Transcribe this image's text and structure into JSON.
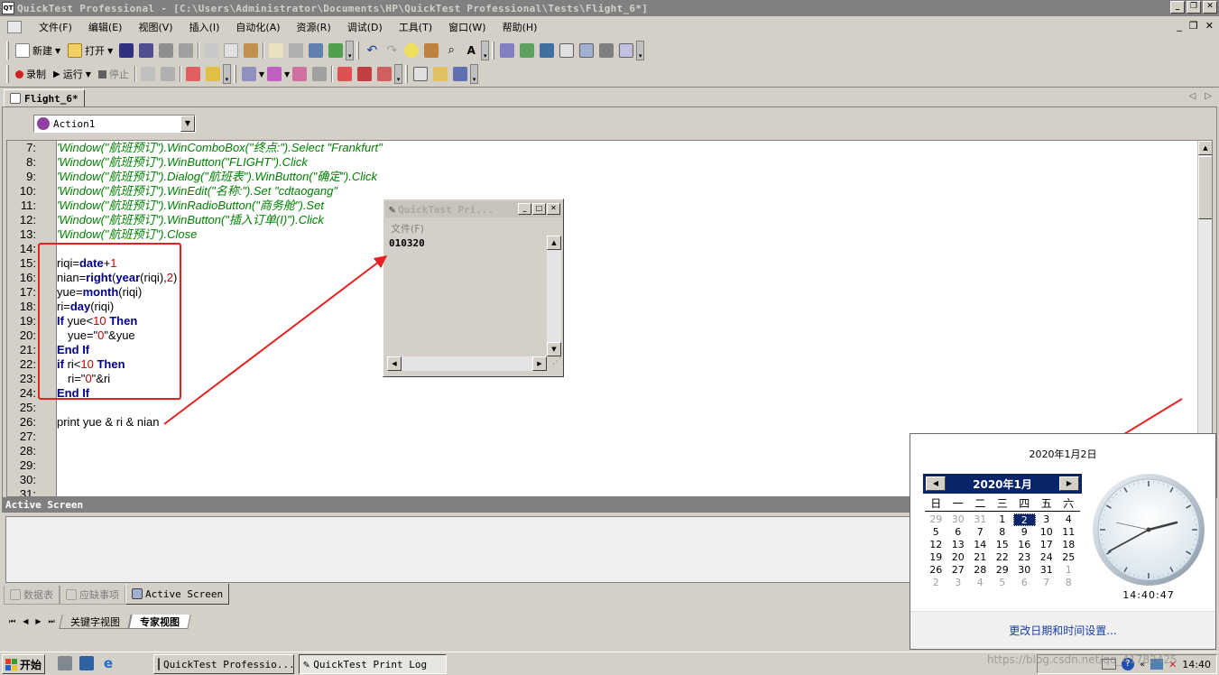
{
  "window": {
    "title": "QuickTest Professional - [C:\\Users\\Administrator\\Documents\\HP\\QuickTest Professional\\Tests\\Flight_6*]"
  },
  "menu": {
    "items": [
      "文件(F)",
      "编辑(E)",
      "视图(V)",
      "插入(I)",
      "自动化(A)",
      "资源(R)",
      "调试(D)",
      "工具(T)",
      "窗口(W)",
      "帮助(H)"
    ]
  },
  "toolbar1": {
    "new_label": "新建",
    "open_label": "打开"
  },
  "toolbar2": {
    "record_label": "录制",
    "run_label": "运行",
    "stop_label": "停止"
  },
  "doc_tab": {
    "label": "Flight_6*"
  },
  "action_combo": {
    "value": "Action1"
  },
  "code_lines": [
    {
      "n": "7:",
      "text": "'Window(\"航班预订\").WinComboBox(\"终点:\").Select \"Frankfurt\""
    },
    {
      "n": "8:",
      "text": "'Window(\"航班预订\").WinButton(\"FLIGHT\").Click"
    },
    {
      "n": "9:",
      "text": "'Window(\"航班预订\").Dialog(\"航班表\").WinButton(\"确定\").Click"
    },
    {
      "n": "10:",
      "text": "'Window(\"航班预订\").WinEdit(\"名称:\").Set \"cdtaogang\""
    },
    {
      "n": "11:",
      "text": "'Window(\"航班预订\").WinRadioButton(\"商务舱\").Set"
    },
    {
      "n": "12:",
      "text": "'Window(\"航班预订\").WinButton(\"插入订单(I)\").Click"
    },
    {
      "n": "13:",
      "text": "'Window(\"航班预订\").Close"
    },
    {
      "n": "14:",
      "text": ""
    },
    {
      "n": "15:",
      "text": "riqi=date+1"
    },
    {
      "n": "16:",
      "text": "nian=right(year(riqi),2)"
    },
    {
      "n": "17:",
      "text": "yue=month(riqi)"
    },
    {
      "n": "18:",
      "text": "ri=day(riqi)"
    },
    {
      "n": "19:",
      "text": "If yue<10 Then"
    },
    {
      "n": "20:",
      "text": "yue=\"0\"&yue"
    },
    {
      "n": "21:",
      "text": "End If"
    },
    {
      "n": "22:",
      "text": "if ri<10 Then"
    },
    {
      "n": "23:",
      "text": "ri=\"0\"&ri"
    },
    {
      "n": "24:",
      "text": "End If"
    },
    {
      "n": "25:",
      "text": ""
    },
    {
      "n": "26:",
      "text": "print yue & ri & nian"
    },
    {
      "n": "27:",
      "text": ""
    },
    {
      "n": "28:",
      "text": ""
    },
    {
      "n": "29:",
      "text": ""
    },
    {
      "n": "30:",
      "text": ""
    },
    {
      "n": "31:",
      "text": ""
    }
  ],
  "print_log": {
    "title": "QuickTest Pri...",
    "menu_file": "文件(F)",
    "output": "010320"
  },
  "active_screen": {
    "header": "Active Screen"
  },
  "bottom_tabs": {
    "data_table": "数据表",
    "missing_resources": "应缺事项",
    "active_screen": "Active Screen"
  },
  "view_tabs": {
    "keyword_view": "关键字视图",
    "expert_view": "专家视图"
  },
  "clock_popup": {
    "date_long": "2020年1月2日",
    "month_title": "2020年1月",
    "weekdays": [
      "日",
      "一",
      "二",
      "三",
      "四",
      "五",
      "六"
    ],
    "weeks": [
      [
        "29",
        "30",
        "31",
        "1",
        "2",
        "3",
        "4"
      ],
      [
        "5",
        "6",
        "7",
        "8",
        "9",
        "10",
        "11"
      ],
      [
        "12",
        "13",
        "14",
        "15",
        "16",
        "17",
        "18"
      ],
      [
        "19",
        "20",
        "21",
        "22",
        "23",
        "24",
        "25"
      ],
      [
        "26",
        "27",
        "28",
        "29",
        "30",
        "31",
        "1"
      ],
      [
        "2",
        "3",
        "4",
        "5",
        "6",
        "7",
        "8"
      ]
    ],
    "selected_day": "2",
    "time": "14:40:47",
    "settings_link": "更改日期和时间设置..."
  },
  "taskbar": {
    "start_label": "开始",
    "tasks": [
      "QuickTest Professio...",
      "QuickTest Print Log"
    ],
    "clock": "14:40"
  },
  "watermark": "https://blog.csdn.net/qq_41782425",
  "colors": {
    "comment": "#008000",
    "keyword": "#00008b",
    "number": "#c00000",
    "highlight_box": "#e52222",
    "calendar_header": "#0a246a"
  }
}
